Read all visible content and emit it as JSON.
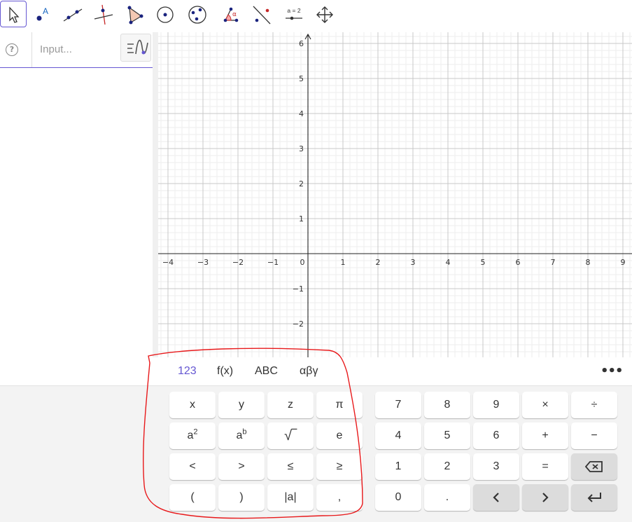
{
  "toolbar": {
    "tools": [
      {
        "name": "move-tool-icon"
      },
      {
        "name": "point-tool-icon"
      },
      {
        "name": "line-tool-icon"
      },
      {
        "name": "perpendicular-line-tool-icon"
      },
      {
        "name": "polygon-tool-icon"
      },
      {
        "name": "circle-tool-icon"
      },
      {
        "name": "circle-three-points-tool-icon"
      },
      {
        "name": "angle-tool-icon"
      },
      {
        "name": "reflect-tool-icon"
      },
      {
        "name": "slider-tool-icon",
        "label": "a = 2"
      },
      {
        "name": "move-graphics-view-tool-icon"
      }
    ],
    "point_label": "A",
    "angle_label": "α"
  },
  "algebra": {
    "help": "?",
    "input_placeholder": "Input..."
  },
  "graph": {
    "x_ticks": [
      "−4",
      "−3",
      "−2",
      "−1",
      "0",
      "1",
      "2",
      "3",
      "4",
      "5",
      "6",
      "7",
      "8",
      "9"
    ],
    "y_ticks": [
      "6",
      "5",
      "4",
      "3",
      "2",
      "1",
      "−1",
      "−2"
    ]
  },
  "keyboard": {
    "tabs": [
      "123",
      "f(x)",
      "ABC",
      "αβγ"
    ],
    "selected_tab": "123",
    "more": "•••",
    "left_keys": [
      [
        "x",
        "y",
        "z",
        "π"
      ],
      [
        "a2",
        "ab",
        "√",
        "e"
      ],
      [
        "<",
        ">",
        "≤",
        "≥"
      ],
      [
        "(",
        ")",
        "|a|",
        ","
      ]
    ],
    "right_keys": [
      [
        "7",
        "8",
        "9",
        "×",
        "÷"
      ],
      [
        "4",
        "5",
        "6",
        "+",
        "−"
      ],
      [
        "1",
        "2",
        "3",
        "=",
        "backspace"
      ],
      [
        "0",
        ".",
        "left",
        "right",
        "enter"
      ]
    ]
  },
  "colors": {
    "accent": "#6557d2",
    "annotation": "#e8191b"
  }
}
